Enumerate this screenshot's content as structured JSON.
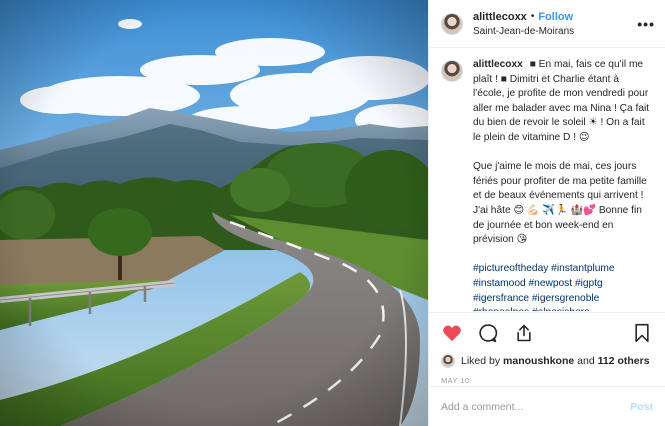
{
  "header": {
    "username": "alittlecoxx",
    "separator": "•",
    "follow_label": "Follow",
    "location": "Saint-Jean-de-Moirans",
    "more_icon": "more-options-icon"
  },
  "caption": {
    "username": "alittlecoxx",
    "paragraph1": "■ En mai, fais ce qu'il me plaît ! ■ Dimitri et Charlie étant à l'école, je profite de mon vendredi pour aller me balader avec ma Nina ! Ça fait du bien de revoir le soleil ☀ ! On a fait le plein de vitamine D ! 😉",
    "paragraph2": "Que j'aime le mois de mai, ces jours fériés pour profiter de ma petite famille et de beaux événements qui arrivent ! J'ai hâte 😊 💪🏻 ✈️🏃 🏰💕 Bonne fin de journée et bon week-end en prévision 😘",
    "hashtags": "#pictureoftheday #instantplume #instamood #newpost #igptg #igersfrance #igersgrenoble #rhonealpes #alpesishere #iserephotographie"
  },
  "actions": {
    "like_icon": "heart-icon",
    "comment_icon": "comment-icon",
    "share_icon": "share-icon",
    "save_icon": "bookmark-icon",
    "liked_by_prefix": "Liked by",
    "liked_by_user": "manoushkone",
    "liked_by_and": "and",
    "liked_by_others": "112 others",
    "date": "MAY 10",
    "accent": "#ed4956"
  },
  "comment_box": {
    "placeholder": "Add a comment...",
    "post_label": "Post"
  },
  "colors": {
    "follow": "#3897f0",
    "hashtag": "#003569",
    "post_disabled": "#b2dffc"
  }
}
